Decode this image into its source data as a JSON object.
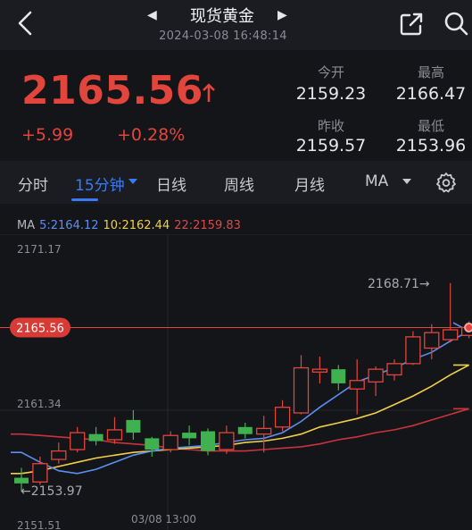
{
  "header": {
    "title": "现货黄金",
    "timestamp": "2024-03-08 16:48:14",
    "back_icon": "chevron-left-icon",
    "share_icon": "share-icon",
    "search_icon": "search-icon"
  },
  "quote": {
    "price": "2165.56",
    "change": "+5.99",
    "change_pct": "+0.28%",
    "direction_icon": "arrow-up-icon",
    "stats": {
      "open_label": "今开",
      "open_value": "2159.23",
      "high_label": "最高",
      "high_value": "2166.47",
      "prev_close_label": "昨收",
      "prev_close_value": "2159.57",
      "low_label": "最低",
      "low_value": "2153.96"
    }
  },
  "tabs": {
    "items": [
      "分时",
      "15分钟",
      "日线",
      "周线",
      "月线",
      "MA"
    ],
    "active": "15分钟"
  },
  "ma_legend": {
    "label": "MA",
    "ma5": "5:2164.12",
    "ma10": "10:2162.44",
    "ma22": "22:2159.83"
  },
  "colors": {
    "up": "#e2453c",
    "down": "#3fb24f",
    "accent": "#3a7bf2",
    "ma5": "#5b8ff2",
    "ma10": "#f2cf4a",
    "ma22": "#c8343a"
  },
  "chart_data": {
    "type": "candlestick",
    "y_axis_labels": [
      "2171.17",
      "2161.34",
      "2151.51"
    ],
    "x_axis_labels": [
      "03/08 13:00"
    ],
    "ylim": [
      2151.51,
      2171.17
    ],
    "current_price_label": "2165.56",
    "max_annotation": "2168.71→",
    "min_annotation": "←2153.97",
    "candles": [
      {
        "o": 2154.9,
        "c": 2154.5,
        "h": 2155.6,
        "l": 2153.97
      },
      {
        "o": 2154.6,
        "c": 2155.9,
        "h": 2156.4,
        "l": 2154.4
      },
      {
        "o": 2156.2,
        "c": 2156.8,
        "h": 2157.4,
        "l": 2155.9
      },
      {
        "o": 2156.9,
        "c": 2158.1,
        "h": 2158.5,
        "l": 2156.7
      },
      {
        "o": 2158.0,
        "c": 2157.5,
        "h": 2158.5,
        "l": 2157.2
      },
      {
        "o": 2157.6,
        "c": 2158.3,
        "h": 2159.2,
        "l": 2157.3
      },
      {
        "o": 2159.0,
        "c": 2158.1,
        "h": 2159.7,
        "l": 2157.6
      },
      {
        "o": 2157.7,
        "c": 2156.9,
        "h": 2157.8,
        "l": 2156.4
      },
      {
        "o": 2156.9,
        "c": 2157.9,
        "h": 2158.2,
        "l": 2156.7
      },
      {
        "o": 2158.1,
        "c": 2157.7,
        "h": 2158.6,
        "l": 2157.2
      },
      {
        "o": 2158.2,
        "c": 2156.8,
        "h": 2158.4,
        "l": 2156.5
      },
      {
        "o": 2156.9,
        "c": 2158.1,
        "h": 2158.6,
        "l": 2156.6
      },
      {
        "o": 2158.5,
        "c": 2158.0,
        "h": 2158.8,
        "l": 2157.7
      },
      {
        "o": 2158.0,
        "c": 2158.4,
        "h": 2159.3,
        "l": 2156.7
      },
      {
        "o": 2158.5,
        "c": 2159.9,
        "h": 2160.4,
        "l": 2158.2
      },
      {
        "o": 2159.5,
        "c": 2162.7,
        "h": 2163.6,
        "l": 2159.4
      },
      {
        "o": 2162.4,
        "c": 2162.6,
        "h": 2163.5,
        "l": 2161.6
      },
      {
        "o": 2162.6,
        "c": 2161.6,
        "h": 2162.9,
        "l": 2161.1
      },
      {
        "o": 2161.2,
        "c": 2161.8,
        "h": 2163.3,
        "l": 2159.4
      },
      {
        "o": 2161.7,
        "c": 2162.6,
        "h": 2162.8,
        "l": 2160.7
      },
      {
        "o": 2162.2,
        "c": 2163.0,
        "h": 2163.3,
        "l": 2161.8
      },
      {
        "o": 2163.0,
        "c": 2164.9,
        "h": 2165.3,
        "l": 2162.9
      },
      {
        "o": 2164.1,
        "c": 2165.2,
        "h": 2165.8,
        "l": 2163.3
      },
      {
        "o": 2164.7,
        "c": 2165.4,
        "h": 2168.71,
        "l": 2164.5
      },
      {
        "o": 2165.0,
        "c": 2165.56,
        "h": 2166.0,
        "l": 2164.8
      }
    ],
    "ma5": [
      2156.7,
      2156.0,
      2155.4,
      2155.2,
      2155.5,
      2156.0,
      2156.5,
      2156.8,
      2157.0,
      2157.1,
      2157.2,
      2157.4,
      2157.6,
      2157.7,
      2158.1,
      2158.9,
      2159.9,
      2160.8,
      2161.7,
      2162.2,
      2162.7,
      2163.3,
      2163.8,
      2164.6,
      2165.3
    ],
    "ma10": [
      2155.2,
      2155.4,
      2155.7,
      2156.0,
      2156.3,
      2156.5,
      2156.7,
      2156.8,
      2156.9,
      2157.0,
      2157.1,
      2157.2,
      2157.4,
      2157.5,
      2157.7,
      2158.0,
      2158.5,
      2158.8,
      2159.1,
      2159.5,
      2160.1,
      2160.7,
      2161.4,
      2162.2,
      2162.9
    ],
    "ma22": [
      2158.0,
      2157.9,
      2157.8,
      2157.7,
      2157.6,
      2157.4,
      2157.3,
      2157.2,
      2157.0,
      2156.9,
      2156.8,
      2156.8,
      2156.8,
      2156.9,
      2157.0,
      2157.1,
      2157.3,
      2157.6,
      2157.8,
      2158.1,
      2158.3,
      2158.6,
      2159.0,
      2159.4,
      2159.8
    ]
  }
}
